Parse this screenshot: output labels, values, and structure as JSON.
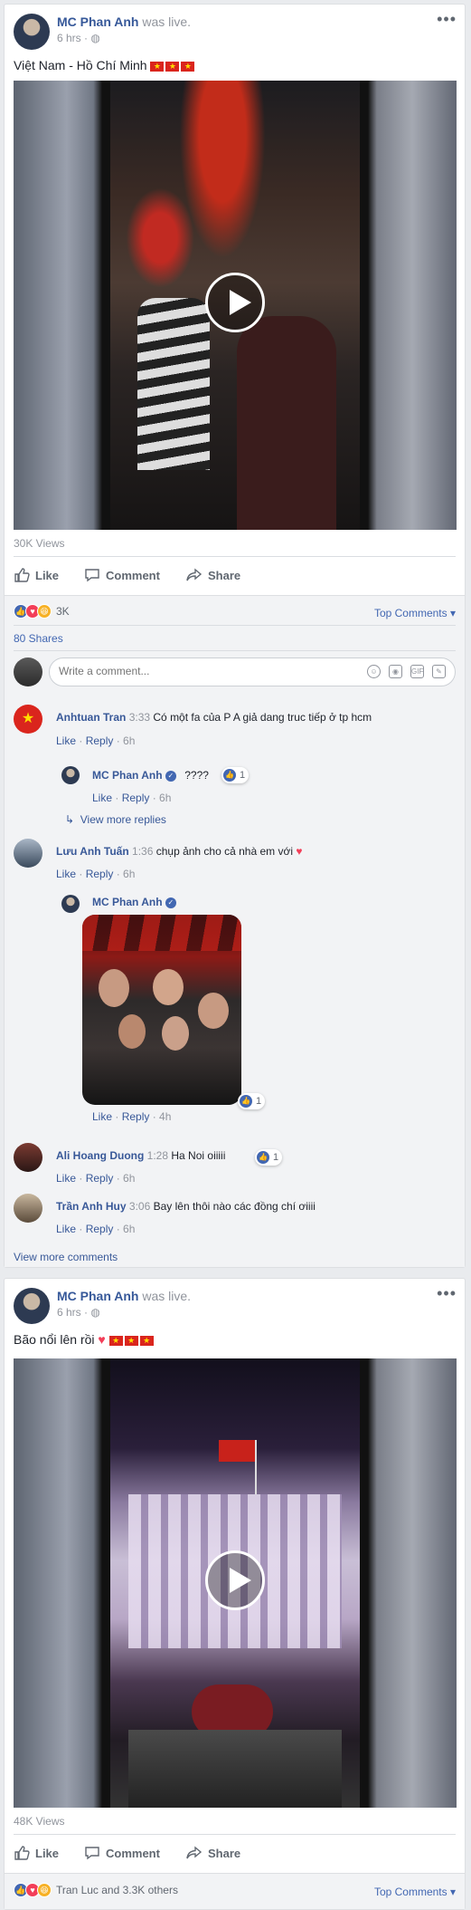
{
  "post1": {
    "author": "MC Phan Anh",
    "was_live": "was live.",
    "time": "6 hrs",
    "text": "Việt Nam - Hồ Chí Minh",
    "views": "30K Views",
    "actions": {
      "like": "Like",
      "comment": "Comment",
      "share": "Share"
    },
    "reaction_count": "3K",
    "top_comments": "Top Comments ▾",
    "shares": "80 Shares",
    "comment_placeholder": "Write a comment...",
    "comments": [
      {
        "name": "Anhtuan Tran",
        "time": "3:33",
        "text": "Có một fa của P A giả dang truc tiếp ở tp hcm",
        "like": "Like",
        "reply": "Reply",
        "age": "6h"
      },
      {
        "name": "MC Phan Anh",
        "time": "",
        "text": "????",
        "like": "Like",
        "reply": "Reply",
        "age": "6h",
        "reactions": "1"
      },
      {
        "view_more_replies": "View more replies"
      },
      {
        "name": "Lưu Anh Tuấn",
        "time": "1:36",
        "text": "chụp ảnh cho cả nhà em với",
        "like": "Like",
        "reply": "Reply",
        "age": "6h"
      },
      {
        "name": "MC Phan Anh",
        "like": "Like",
        "reply": "Reply",
        "age": "4h",
        "reactions": "1"
      },
      {
        "name": "Ali Hoang Duong",
        "time": "1:28",
        "text": "Ha Noi oiiiii",
        "like": "Like",
        "reply": "Reply",
        "age": "6h",
        "reactions": "1"
      },
      {
        "name": "Trần Anh Huy",
        "time": "3:06",
        "text": "Bay lên thôi nào các đồng chí ơiiii",
        "like": "Like",
        "reply": "Reply",
        "age": "6h"
      }
    ],
    "view_more_comments": "View more comments"
  },
  "post2": {
    "author": "MC Phan Anh",
    "was_live": "was live.",
    "time": "6 hrs",
    "text": "Bão nổi lên rồi",
    "views": "48K Views",
    "actions": {
      "like": "Like",
      "comment": "Comment",
      "share": "Share"
    },
    "reaction_text": "Tran Luc and 3.3K others",
    "top_comments": "Top Comments ▾"
  },
  "colors": {
    "link": "#385898",
    "accent": "#4267b2",
    "flag": "#da251d",
    "page_bg": "#e9ebee"
  }
}
